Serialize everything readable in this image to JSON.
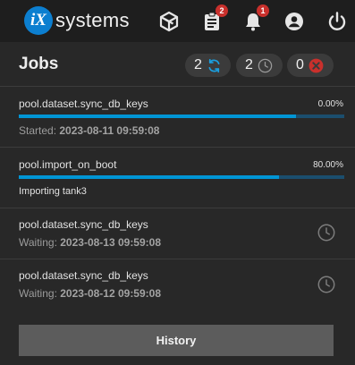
{
  "topbar": {
    "logo_mark": "iX",
    "logo_text": "systems",
    "tasks_badge": "2",
    "alerts_badge": "1"
  },
  "panel": {
    "title": "Jobs",
    "counters": {
      "running": "2",
      "waiting": "2",
      "failed": "0"
    }
  },
  "jobs": [
    {
      "name": "pool.dataset.sync_db_keys",
      "percent_label": "0.00%",
      "progress": 0.0,
      "meta_label": "Started:",
      "meta_time": "2023-08-11 09:59:08"
    },
    {
      "name": "pool.import_on_boot",
      "percent_label": "80.00%",
      "progress": 0.8,
      "description": "Importing tank3"
    },
    {
      "name": "pool.dataset.sync_db_keys",
      "meta_label": "Waiting:",
      "meta_time": "2023-08-13 09:59:08"
    },
    {
      "name": "pool.dataset.sync_db_keys",
      "meta_label": "Waiting:",
      "meta_time": "2023-08-12 09:59:08"
    }
  ],
  "history_label": "History",
  "colors": {
    "accent": "#0095d5",
    "danger": "#c9302c",
    "background": "#282828",
    "topbar": "#1e1e1e"
  },
  "icons": [
    "truecommand-icon",
    "clipboard-tasks-icon",
    "bell-icon",
    "account-circle-icon",
    "power-icon",
    "sync-icon",
    "clock-icon",
    "cancel-icon"
  ]
}
